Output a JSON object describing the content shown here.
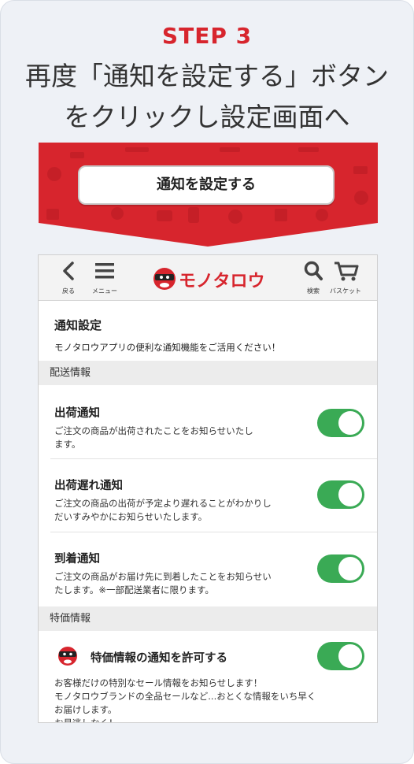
{
  "step": {
    "label": "STEP 3",
    "title_line1": "再度「通知を設定する」ボタン",
    "title_line2": "をクリックし設定画面へ"
  },
  "banner": {
    "button_label": "通知を設定する",
    "background_color": "#d7252d"
  },
  "app_header": {
    "back_label": "戻る",
    "menu_label": "メニュー",
    "logo_text": "モノタロウ",
    "search_label": "検索",
    "basket_label": "バスケット"
  },
  "notification_settings": {
    "title": "通知設定",
    "description": "モノタロウアプリの便利な通知機能をご活用ください！"
  },
  "sections": [
    {
      "header": "配送情報",
      "items": [
        {
          "title": "出荷通知",
          "desc_line1": "ご注文の商品が出荷されたことをお知らせいたし",
          "desc_line2": "ます。",
          "enabled": true
        },
        {
          "title": "出荷遅れ通知",
          "desc_line1": "ご注文の商品の出荷が予定より遅れることがわかりし",
          "desc_line2": "だいすみやかにお知らせいたします。",
          "enabled": true
        },
        {
          "title": "到着通知",
          "desc_line1": "ご注文の商品がお届け先に到着したことをお知らせい",
          "desc_line2": "たします。※一部配送業者に限ります。",
          "enabled": true
        }
      ]
    },
    {
      "header": "特価情報",
      "items": [
        {
          "title": "特価情報の通知を許可する",
          "desc_line1": "お客様だけの特別なセール情報をお知らせします！",
          "desc_line2": "モノタロウブランドの全品セールなど...おとくな情報をいち早く",
          "desc_line3": "お届けします。",
          "desc_line4": "お見逃しなく！",
          "enabled": true
        }
      ]
    }
  ],
  "colors": {
    "accent_red": "#d7252d",
    "toggle_on": "#3aaa55"
  }
}
